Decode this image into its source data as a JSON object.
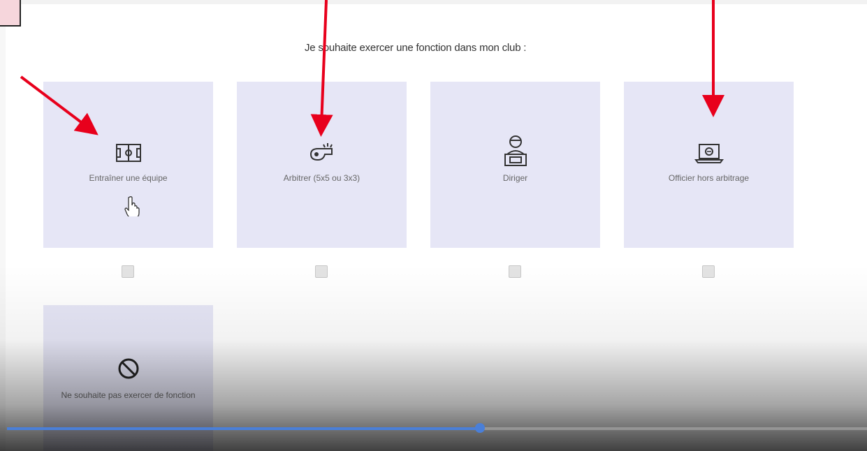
{
  "prompt": "Je souhaite exercer une fonction dans mon club :",
  "options": [
    {
      "label": "Entraîner une équipe",
      "icon": "court-icon",
      "checked": false
    },
    {
      "label": "Arbitrer (5x5 ou 3x3)",
      "icon": "whistle-icon",
      "checked": false
    },
    {
      "label": "Diriger",
      "icon": "manager-desk-icon",
      "checked": false
    },
    {
      "label": "Officier hors arbitrage",
      "icon": "laptop-icon",
      "checked": false
    }
  ],
  "option_none": {
    "label": "Ne souhaite pas exercer de fonction",
    "icon": "prohibited-icon"
  },
  "video": {
    "progress_fraction": 0.55
  },
  "colors": {
    "card": "#e6e6f6",
    "annotation_arrow": "#e8001c",
    "progress": "#4a7fd8"
  }
}
